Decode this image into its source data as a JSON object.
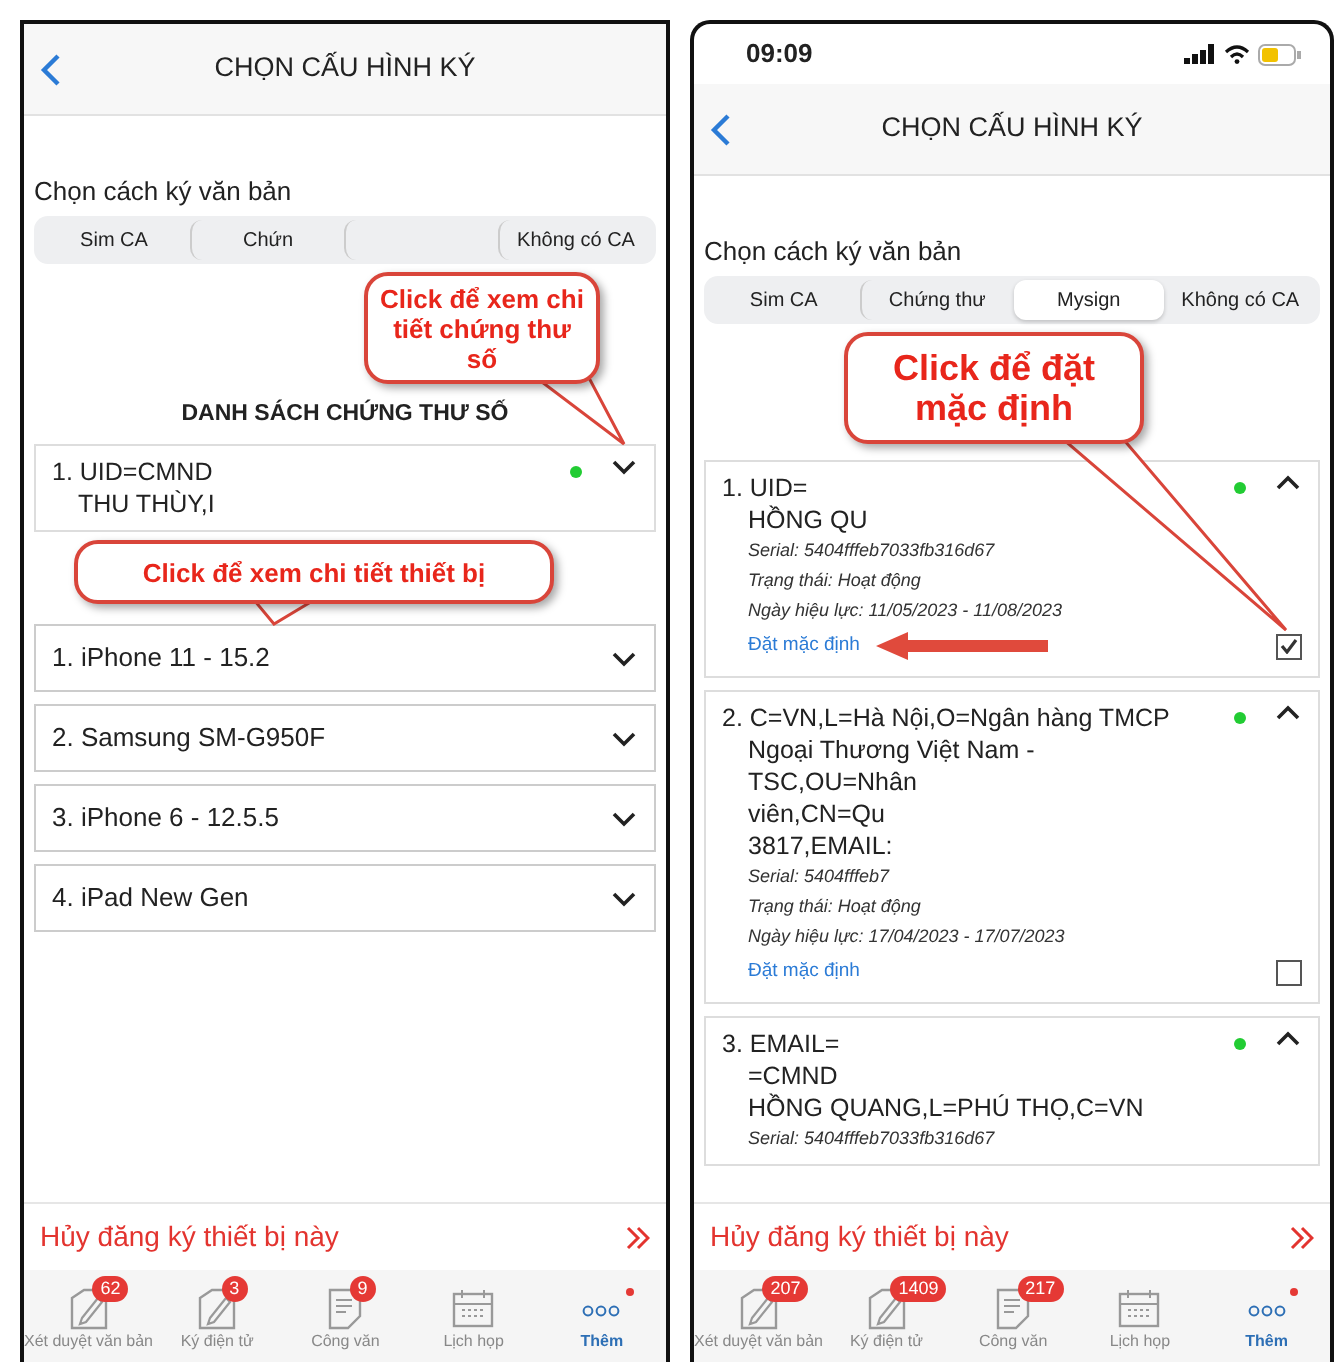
{
  "screens": [
    {
      "header": {
        "title": "CHỌN CẤU HÌNH KÝ"
      },
      "section_label": "Chọn cách ký văn bản",
      "tabs": [
        {
          "label": "Sim CA",
          "selected": false
        },
        {
          "label": "Chứn",
          "selected": false
        },
        {
          "selected": false
        },
        {
          "label": "Không có CA",
          "selected": false
        }
      ],
      "list_heading": "DANH SÁCH CHỨNG THƯ SỐ",
      "certificates": [
        {
          "lines": [
            "1. UID=CMND",
            "THU THÙY,I"
          ],
          "active": true,
          "expanded": false
        }
      ],
      "devices": [
        {
          "label": "1. iPhone 11 - 15.2",
          "expanded": false
        },
        {
          "label": "2. Samsung SM-G950F",
          "expanded": false
        },
        {
          "label": "3. iPhone 6 - 12.5.5",
          "expanded": false
        },
        {
          "label": "4. iPad New Gen",
          "expanded": false
        }
      ],
      "unregister": "Hủy đăng ký thiết bị này",
      "bottom_nav": [
        {
          "kind": "edit",
          "label": "Xét duyệt văn bản",
          "badge": "62",
          "selected": false,
          "notification": false
        },
        {
          "kind": "edit",
          "label": "Ký điện tử",
          "badge": "3",
          "selected": false,
          "notification": false
        },
        {
          "kind": "document",
          "label": "Công văn",
          "badge": "9",
          "selected": false,
          "notification": false
        },
        {
          "kind": "calendar",
          "label": "Lịch họp",
          "selected": false,
          "notification": false
        },
        {
          "kind": "more",
          "label": "Thêm",
          "selected": true,
          "notification": true
        }
      ],
      "callouts": [
        {
          "kind": "certificate",
          "text": "Click để xem chi tiết chứng thư số"
        },
        {
          "kind": "device",
          "text": "Click để xem chi tiết thiết bị"
        }
      ]
    },
    {
      "status_bar": {
        "time": "09:09"
      },
      "header": {
        "title": "CHỌN CẤU HÌNH KÝ"
      },
      "section_label": "Chọn cách ký văn bản",
      "tabs": [
        {
          "label": "Sim CA",
          "selected": false
        },
        {
          "label": "Chứng thư",
          "selected": false
        },
        {
          "label": "Mysign",
          "selected": true
        },
        {
          "label": "Không có CA",
          "selected": false
        }
      ],
      "certificates": [
        {
          "lines": [
            "1. UID=",
            "HỒNG QU"
          ],
          "active": true,
          "expanded": true,
          "details": [
            "Serial: 5404fffeb7033fb316d67",
            "Trạng thái: Hoạt động",
            "Ngày hiệu lực: 11/05/2023 - 11/08/2023"
          ],
          "default_label": "Đặt mặc định",
          "checked": true
        },
        {
          "lines": [
            "2. C=VN,L=Hà Nội,O=Ngân hàng TMCP",
            "Ngoại Thương Việt Nam -",
            "TSC,OU=Nhân",
            "viên,CN=Qu",
            "3817,EMAIL:"
          ],
          "active": true,
          "expanded": true,
          "details": [
            "Serial: 5404fffeb7",
            "Trạng thái: Hoạt động",
            "Ngày hiệu lực: 17/04/2023 - 17/07/2023"
          ],
          "default_label": "Đặt mặc định",
          "checked": false
        },
        {
          "lines": [
            "3. EMAIL=",
            "=CMND",
            "HỒNG QUANG,L=PHÚ THỌ,C=VN"
          ],
          "active": true,
          "expanded": true,
          "details": [
            "Serial: 5404fffeb7033fb316d67"
          ]
        }
      ],
      "unregister": "Hủy đăng ký thiết bị này",
      "bottom_nav": [
        {
          "kind": "edit",
          "label": "Xét duyệt văn bản",
          "badge": "207",
          "selected": false,
          "notification": false
        },
        {
          "kind": "edit",
          "label": "Ký điện tử",
          "badge": "1409",
          "selected": false,
          "notification": false
        },
        {
          "kind": "document",
          "label": "Công văn",
          "badge": "217",
          "selected": false,
          "notification": false
        },
        {
          "kind": "calendar",
          "label": "Lịch họp",
          "selected": false,
          "notification": false
        },
        {
          "kind": "more",
          "label": "Thêm",
          "selected": true,
          "notification": true
        }
      ],
      "callouts": [
        {
          "kind": "default",
          "text": "Click để đặt mặc định"
        }
      ]
    }
  ]
}
